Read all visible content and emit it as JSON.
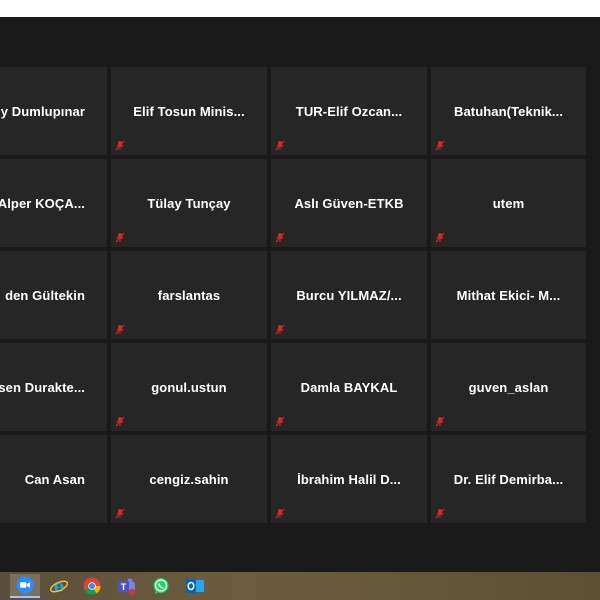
{
  "participants": [
    {
      "name": "y Dumlupınar",
      "muted": false
    },
    {
      "name": "Elif  Tosun  Minis...",
      "muted": true
    },
    {
      "name": "TUR-Elif  Ozcan...",
      "muted": true
    },
    {
      "name": "Batuhan(Teknik...",
      "muted": true
    },
    {
      "name": "Alper  KOÇA...",
      "muted": false
    },
    {
      "name": "Tülay Tunçay",
      "muted": true
    },
    {
      "name": "Aslı Güven-ETKB",
      "muted": true
    },
    {
      "name": "utem",
      "muted": true
    },
    {
      "name": "den Gültekin",
      "muted": false
    },
    {
      "name": "farslantas",
      "muted": true
    },
    {
      "name": "Burcu  YILMAZ/...",
      "muted": true
    },
    {
      "name": "Mithat  Ekici-  M...",
      "muted": false
    },
    {
      "name": "sen  Durakte...",
      "muted": false
    },
    {
      "name": "gonul.ustun",
      "muted": true
    },
    {
      "name": "Damla BAYKAL",
      "muted": true
    },
    {
      "name": "guven_aslan",
      "muted": true
    },
    {
      "name": "Can Asan",
      "muted": false
    },
    {
      "name": "cengiz.sahin",
      "muted": true
    },
    {
      "name": "İbrahim  Halil  D...",
      "muted": true
    },
    {
      "name": "Dr.  Elif  Demirba...",
      "muted": true
    }
  ],
  "taskbar": {
    "icons": [
      "zoom-icon",
      "internet-explorer-icon",
      "chrome-icon",
      "teams-icon",
      "whatsapp-icon",
      "outlook-icon"
    ]
  },
  "colors": {
    "background": "#1a1a1a",
    "tile": "#262626",
    "muted_icon": "#e02828"
  }
}
